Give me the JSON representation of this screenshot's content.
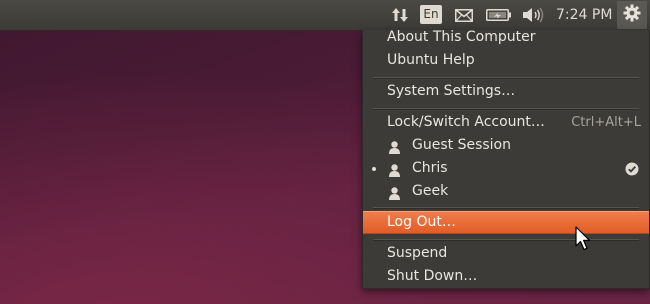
{
  "topbar": {
    "language_label": "En",
    "clock": "7:24 PM",
    "icons": [
      "network-updown-icon",
      "keyboard-language-icon",
      "mail-icon",
      "battery-icon",
      "volume-icon",
      "session-gear-icon"
    ]
  },
  "session_menu": {
    "about": "About This Computer",
    "help": "Ubuntu Help",
    "settings": "System Settings…",
    "lock": "Lock/Switch Account…",
    "lock_accel": "Ctrl+Alt+L",
    "users": [
      {
        "name": "Guest Session",
        "current": false,
        "logged_in": false
      },
      {
        "name": "Chris",
        "current": true,
        "logged_in": true
      },
      {
        "name": "Geek",
        "current": false,
        "logged_in": false
      }
    ],
    "logout": "Log Out…",
    "suspend": "Suspend",
    "shutdown": "Shut Down…"
  },
  "colors": {
    "panel": "#3c3b37",
    "highlight": "#e9682f",
    "text": "#e9e6df"
  }
}
